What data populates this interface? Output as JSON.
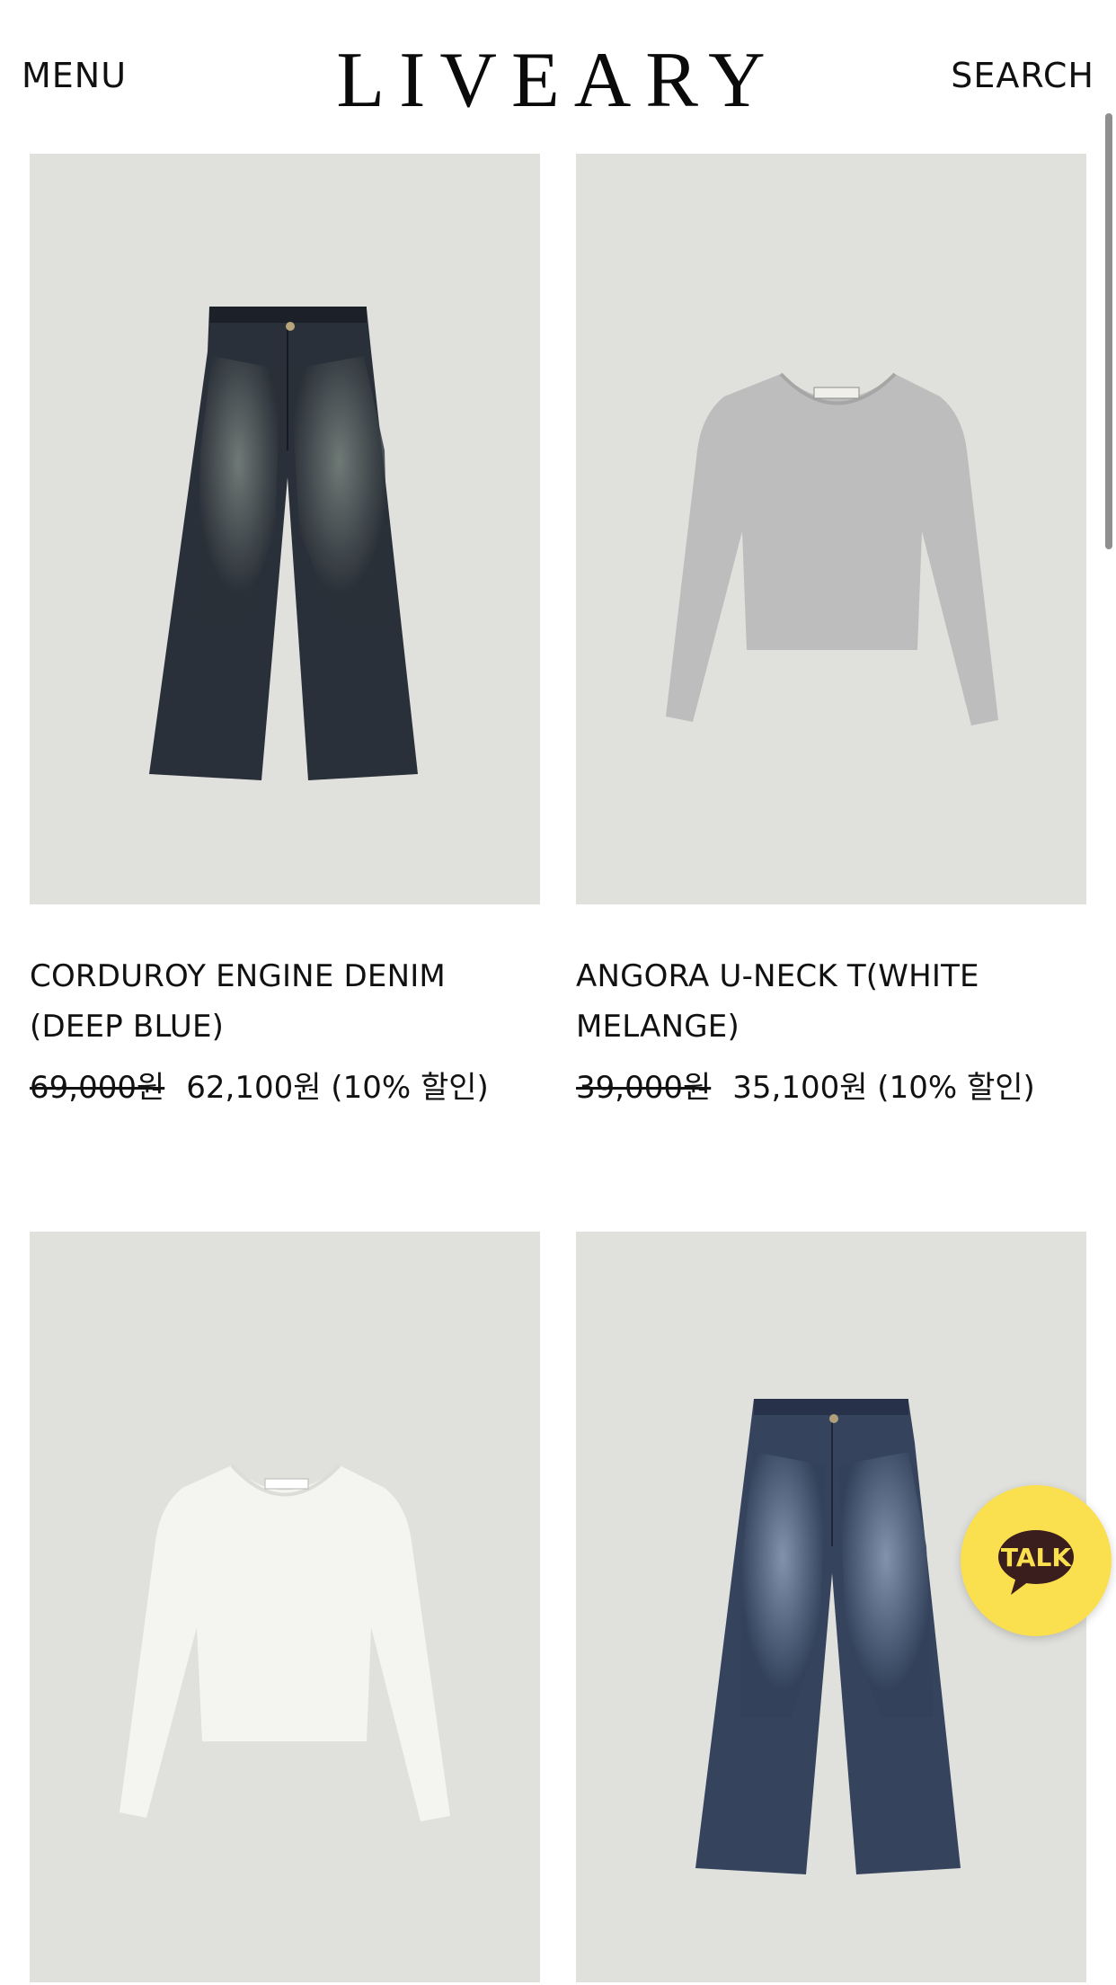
{
  "header": {
    "menu_label": "MENU",
    "logo_text": "LIVEARY",
    "search_label": "SEARCH"
  },
  "products": [
    {
      "name": "CORDUROY ENGINE DENIM (DEEP BLUE)",
      "original_price": "69,000원",
      "sale_price": "62,100원 (10% 할인)",
      "image_icon": "dark-denim-jeans"
    },
    {
      "name": "ANGORA U-NECK T(WHITE MELANGE)",
      "original_price": "39,000원",
      "sale_price": "35,100원 (10% 할인)",
      "image_icon": "grey-long-sleeve-top"
    },
    {
      "name": "",
      "original_price": "",
      "sale_price": "",
      "image_icon": "white-long-sleeve-top"
    },
    {
      "name": "",
      "original_price": "",
      "sale_price": "",
      "image_icon": "blue-denim-jeans"
    }
  ],
  "talk_button": {
    "label": "TALK",
    "color": "#fae04e"
  },
  "colors": {
    "image_background": "#e0e0dd",
    "text": "#111111"
  }
}
